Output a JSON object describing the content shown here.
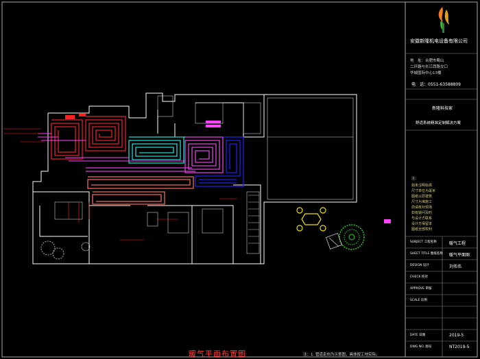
{
  "title_block": {
    "company": "安徽新隆机电设备有限公司",
    "address": [
      "地　址：合肥市蜀山",
      "二环路与长江西路交口",
      "华城国际中心13楼"
    ],
    "phone": "电　话：0551-63588809",
    "project_name": "新隆科技家",
    "project_subtitle": "舒适系统精准定制解决方案",
    "note_label": "注：",
    "notes": [
      "如未注明标高",
      "尺寸单位为毫米",
      "图纸以原建筑",
      "尺寸为准施工",
      "前请核对现场",
      "如有疑问及时",
      "与设计方联系",
      "设计方保留本",
      "图纸全部权利"
    ],
    "rows": [
      {
        "label": "SUBJECT 工程名称",
        "value": "暖气工程"
      },
      {
        "label": "SHEET TITLE 图纸名称",
        "value": "暖气平面图"
      },
      {
        "label": "DESIGN 设计",
        "value": "刘伟伟"
      },
      {
        "label": "CHECK 校对",
        "value": ""
      },
      {
        "label": "APPROVE 审核",
        "value": ""
      },
      {
        "label": "SCALE 比例",
        "value": ""
      },
      {
        "label": "DATE 日期",
        "value": "2019-5"
      },
      {
        "label": "DWG NO. 图号",
        "value": "NT2019-5"
      }
    ]
  },
  "drawing": {
    "title": "暖气平面布置图",
    "footnote": "注：1. 管道走向为示意图，具体按工地实际。",
    "pipe_colors": {
      "red": "#e0202c",
      "cyan": "#20d8d8",
      "magenta": "#e040e0",
      "blue": "#2020e8",
      "salmon": "#f06a5a",
      "wall": "#ffffff",
      "label": "#ff2020",
      "accent_pink": "#ff40ff",
      "plant": "#20e020",
      "furniture": "#f0e000"
    }
  }
}
